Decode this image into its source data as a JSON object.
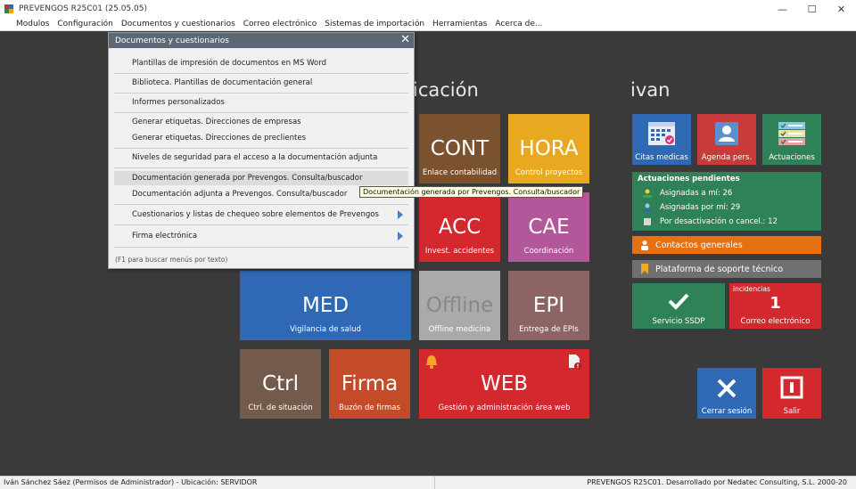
{
  "window": {
    "title": "PREVENGOS R25C01 (25.05.05)",
    "minimize": "—",
    "maximize": "☐",
    "close": "✕"
  },
  "menubar": [
    "Modulos",
    "Configuración",
    "Documentos y cuestionarios",
    "Correo electrónico",
    "Sistemas de importación",
    "Herramientas",
    "Acerca de..."
  ],
  "sections": {
    "left_title": "icación",
    "right_title": "ivan"
  },
  "tiles": {
    "cont": {
      "big": "CONT",
      "sub": "Enlace contabilidad",
      "color": "#7b5230"
    },
    "hora": {
      "big": "HORA",
      "sub": "Control proyectos",
      "color": "#e8a920"
    },
    "acc": {
      "big": "ACC",
      "sub": "Invest. accidentes",
      "color": "#d3282e"
    },
    "cae": {
      "big": "CAE",
      "sub": "Coordinación",
      "color": "#b3579b"
    },
    "med": {
      "big": "MED",
      "sub": "Vigilancia de salud",
      "color": "#2f68b4"
    },
    "offline": {
      "big": "Offline",
      "sub": "Offline medicina",
      "color": "#aaaaaa"
    },
    "epi": {
      "big": "EPI",
      "sub": "Entrega de EPIs",
      "color": "#8c6464"
    },
    "ctrl": {
      "big": "Ctrl",
      "sub": "Ctrl. de situación",
      "color": "#735a4a"
    },
    "firma": {
      "big": "Firma",
      "sub": "Buzón de firmas",
      "color": "#c44b2a"
    },
    "web": {
      "big": "WEB",
      "sub": "Gestión y administración área web",
      "color": "#d3282e"
    }
  },
  "right_tiles": {
    "citas": {
      "label": "Citas medicas",
      "color": "#2f68b4"
    },
    "agenda": {
      "label": "Agenda pers.",
      "color": "#c93a3a"
    },
    "actuaciones": {
      "label": "Actuaciones",
      "color": "#2f8258"
    },
    "servicio": {
      "label": "Servicio SSDP",
      "color": "#2f8258"
    },
    "correo": {
      "badge": "incidencias",
      "count": "1",
      "label": "Correo electrónico",
      "color": "#d3282e"
    },
    "cerrar": {
      "label": "Cerrar sesión",
      "color": "#2f68b4"
    },
    "salir": {
      "label": "Salir",
      "color": "#d3282e"
    }
  },
  "pending": {
    "title": "Actuaciones pendientes",
    "rows": [
      "Asignadas a mí: 26",
      "Asignadas por mí: 29",
      "Por desactivación o cancel.: 12"
    ]
  },
  "bars": {
    "contactos": {
      "label": "Contactos generales",
      "color": "#e8700f"
    },
    "plataforma": {
      "label": "Plataforma de soporte técnico",
      "color": "#707070"
    }
  },
  "dropdown": {
    "title": "Documentos y cuestionarios",
    "items": [
      "Plantillas de impresión de documentos en MS Word",
      "Biblioteca. Plantillas de documentación general",
      "Informes personalizados",
      "Generar etiquetas. Direcciones de empresas",
      "Generar etiquetas. Direcciones de preclientes",
      "Niveles de seguridad para el acceso a la documentación adjunta",
      "Documentación generada por Prevengos. Consulta/buscador",
      "Documentación adjunta a Prevengos. Consulta/buscador",
      "Cuestionarios y listas de chequeo sobre elementos de Prevengos",
      "Firma electrónica"
    ],
    "hint": "(F1 para buscar menús por texto)"
  },
  "tooltip": "Documentación generada por Prevengos. Consulta/buscador",
  "statusbar": {
    "left": "Iván Sánchez Sáez   (Permisos de Administrador)  -  Ubicación: SERVIDOR",
    "right": "PREVENGOS R25C01. Desarrollado por Nedatec Consulting, S.L. 2000-20"
  }
}
